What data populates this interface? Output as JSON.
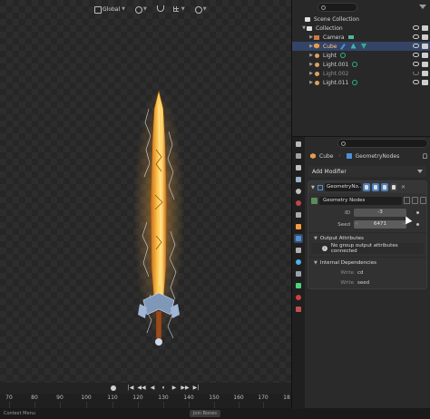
{
  "viewport": {
    "header": {
      "orientation": "Global"
    }
  },
  "playback": {
    "controls": [
      "|◀",
      "◀◀",
      "◀",
      "⏸",
      "▶",
      "▶▶",
      "▶|"
    ]
  },
  "timeline": {
    "ticks": [
      "70",
      "80",
      "90",
      "100",
      "110",
      "120",
      "130",
      "140",
      "150",
      "160",
      "170",
      "18"
    ]
  },
  "status": {
    "items": [
      "Context Menu",
      "Join Bones"
    ]
  },
  "outliner": {
    "rows": [
      {
        "label": "Scene Collection",
        "icon": "scene-collection-icon",
        "depth": 0
      },
      {
        "label": "Collection",
        "icon": "collection-icon",
        "depth": 1
      },
      {
        "label": "Camera",
        "icon": "camera-icon",
        "depth": 2
      },
      {
        "label": "Cube",
        "icon": "cube-icon",
        "depth": 2
      },
      {
        "label": "Light",
        "icon": "light-icon",
        "depth": 2
      },
      {
        "label": "Light.001",
        "icon": "light-icon",
        "depth": 2
      },
      {
        "label": "Light.002",
        "icon": "light-icon",
        "depth": 2
      },
      {
        "label": "Light.011",
        "icon": "light-icon",
        "depth": 2
      }
    ]
  },
  "properties": {
    "breadcrumb": {
      "object": "Cube",
      "modifier": "GeometryNodes"
    },
    "add_modifier": "Add Modifier",
    "modifier": {
      "name": "GeometryNo...",
      "node_group": "Geometry Nodes",
      "fields": [
        {
          "label": "ID",
          "value": "-3"
        },
        {
          "label": "Seed",
          "value": "6471"
        }
      ],
      "output_attributes_header": "Output Attributes",
      "output_attributes_info": "No group output attributes connected",
      "internal_dependencies_header": "Internal Dependencies",
      "dependencies": [
        {
          "label": "Write",
          "value": "cd"
        },
        {
          "label": "Write",
          "value": "seed"
        }
      ]
    }
  },
  "colors": {
    "accent": "#4d90d6",
    "sword_core": "#f3a93a",
    "lightning": "#e8ecff"
  }
}
